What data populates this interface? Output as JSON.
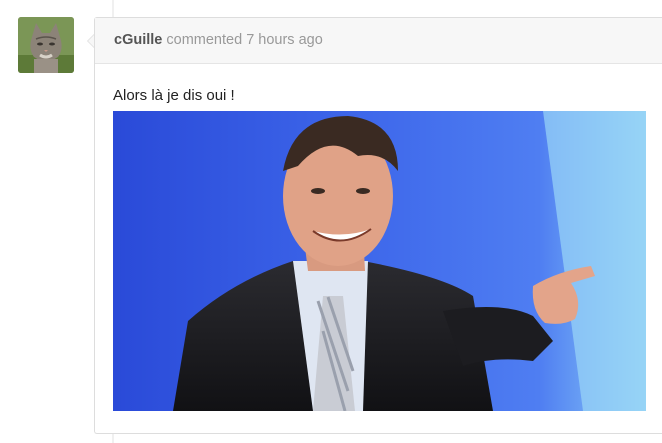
{
  "comment": {
    "author": "cGuille",
    "action": "commented",
    "timestamp": "7 hours ago",
    "body_text": "Alors là je dis oui !",
    "image_description": "photo"
  },
  "colors": {
    "header_bg": "#f7f7f7",
    "border": "#dddddd",
    "author": "#555555",
    "meta": "#999999"
  },
  "icons": {
    "avatar": "cat-avatar"
  }
}
